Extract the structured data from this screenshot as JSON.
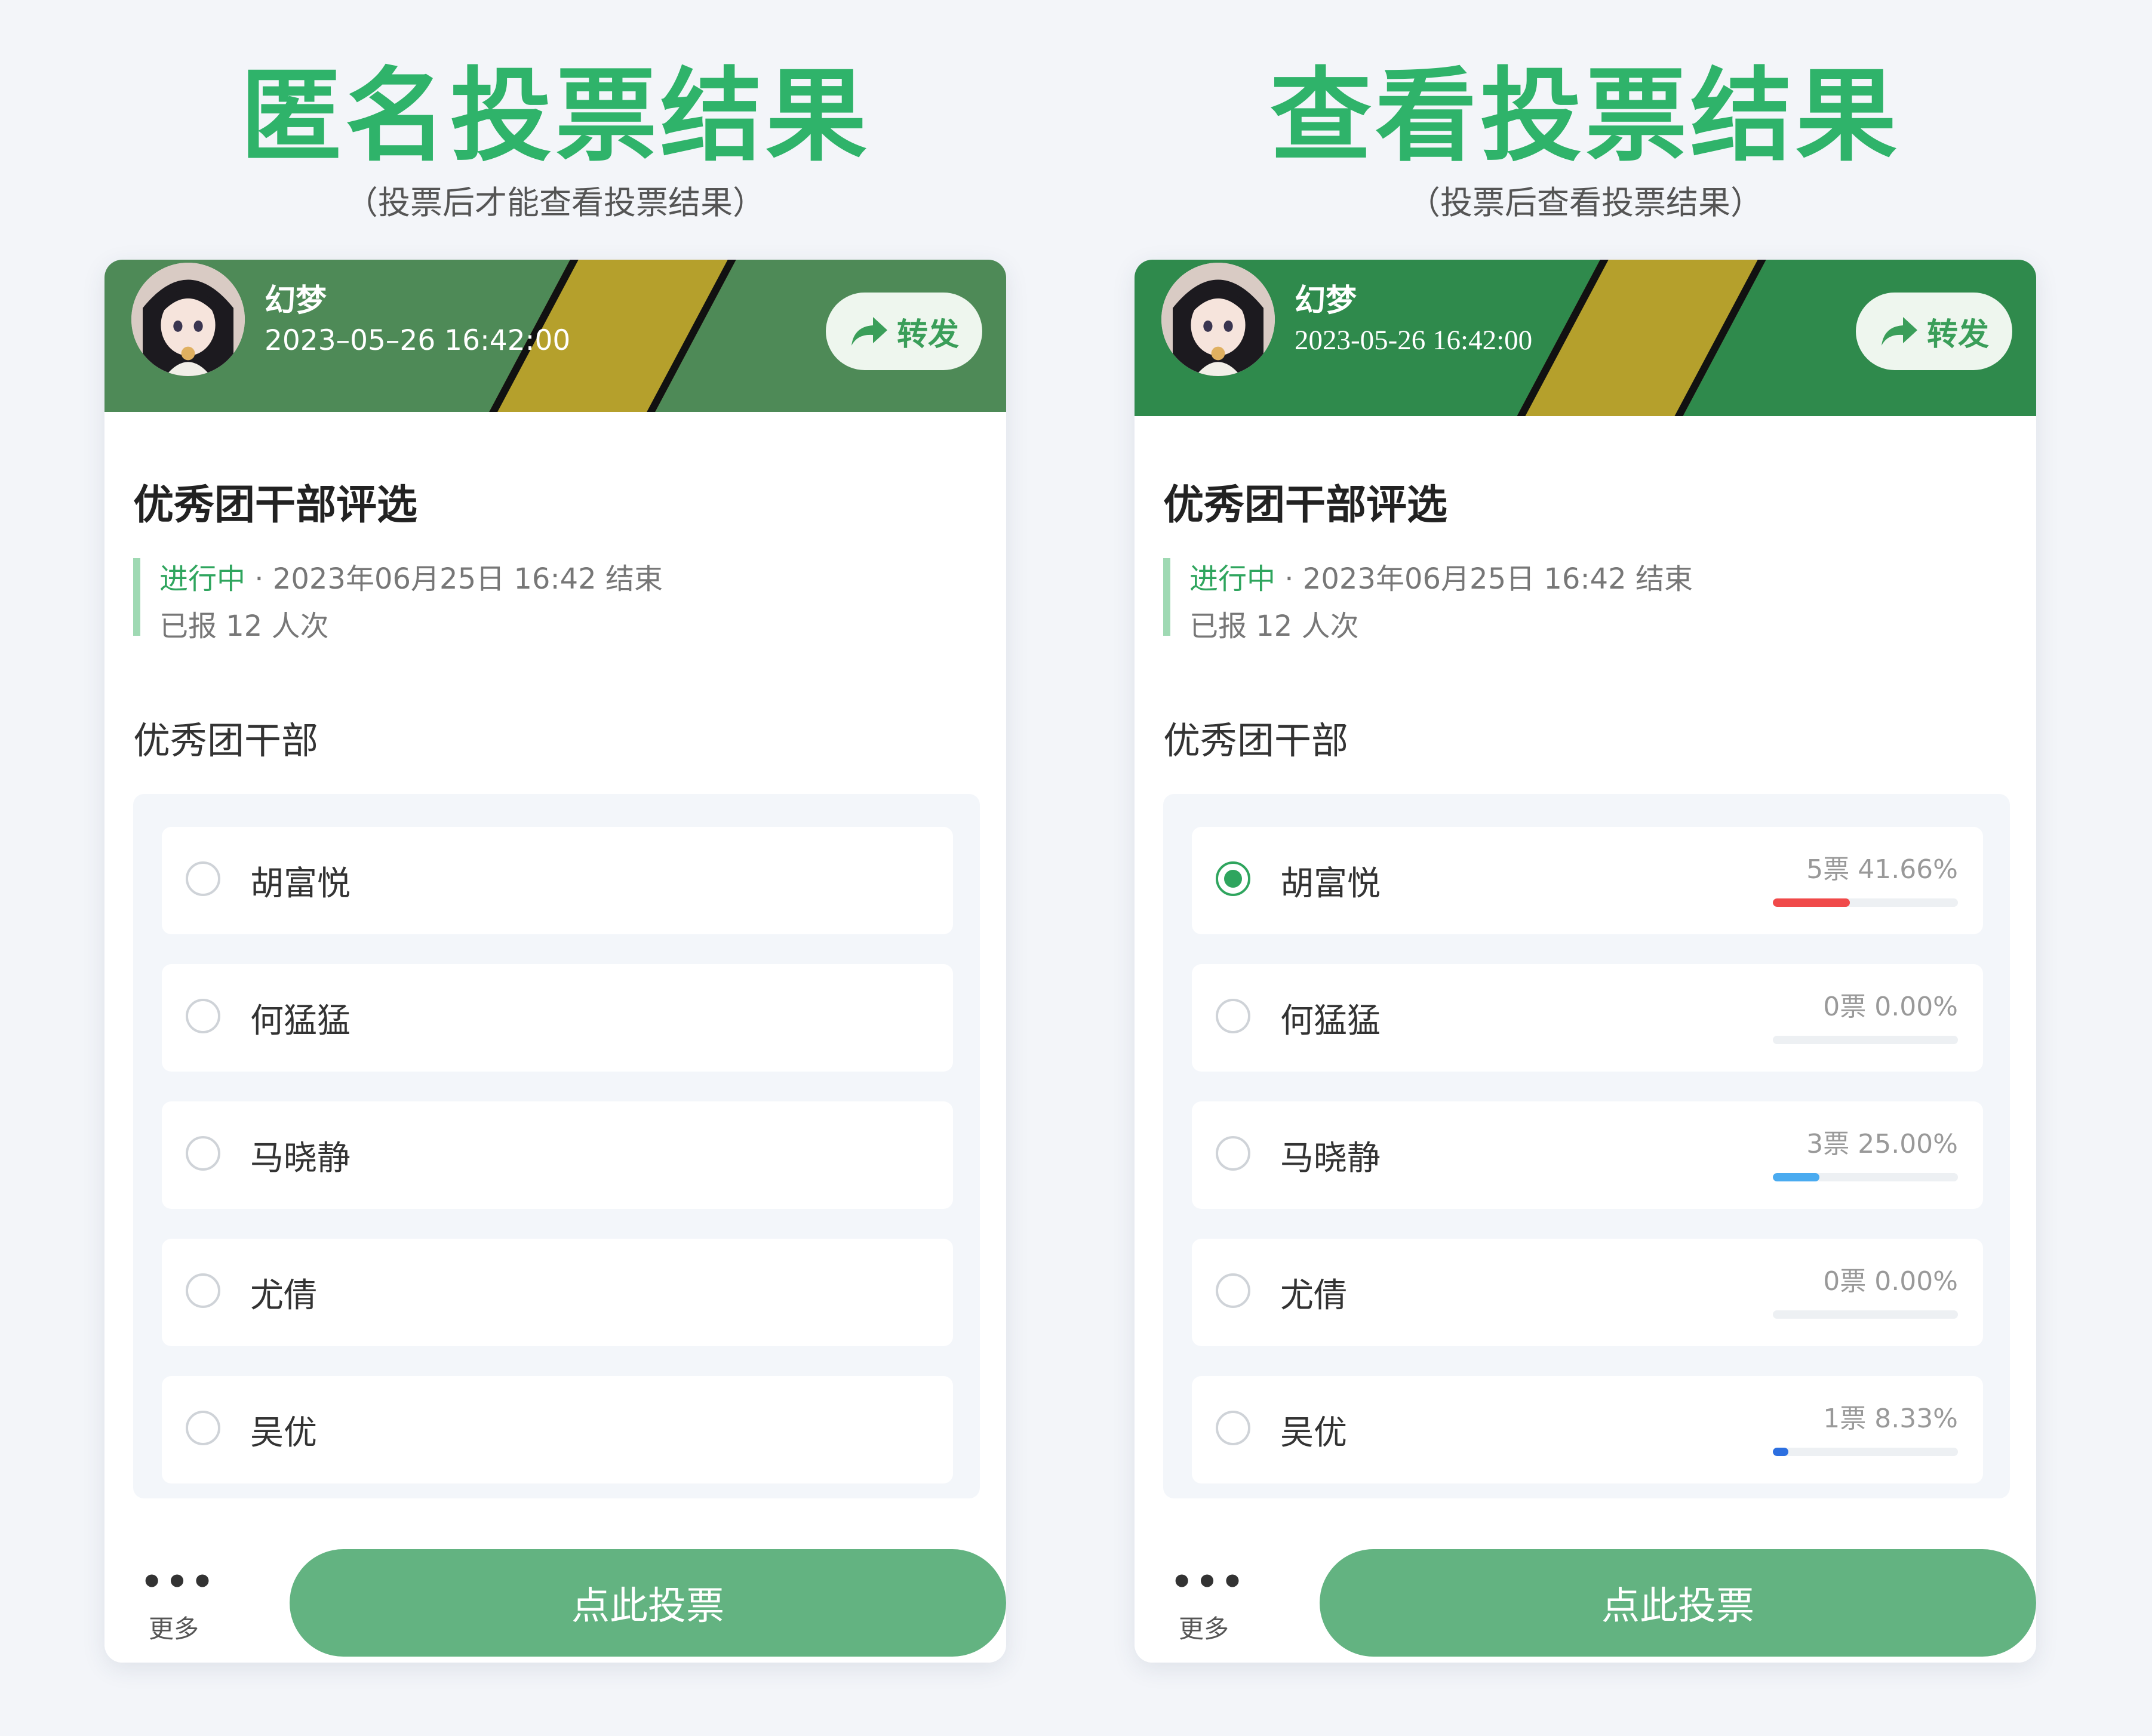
{
  "left": {
    "heading": "匿名投票结果",
    "subheading": "（投票后才能查看投票结果）",
    "user": {
      "name": "幻梦",
      "datetime": "2023–05–26 16:42:00"
    },
    "share_label": "转发",
    "vote_title": "优秀团干部评选",
    "status": {
      "state": "进行中",
      "separator": " · ",
      "end_text": "2023年06月25日 16:42 结束"
    },
    "participant_count": "已报 12 人次",
    "question": "优秀团干部",
    "options": [
      {
        "name": "胡富悦"
      },
      {
        "name": "何猛猛"
      },
      {
        "name": "马晓静"
      },
      {
        "name": "尤倩"
      },
      {
        "name": "吴优"
      }
    ],
    "footer": {
      "more_icon": "•••",
      "more_label": "更多",
      "vote_button": "点此投票"
    }
  },
  "right": {
    "heading": "查看投票结果",
    "subheading": "（投票后查看投票结果）",
    "user": {
      "name": "幻梦",
      "datetime": "2023-05-26 16:42:00"
    },
    "share_label": "转发",
    "vote_title": "优秀团干部评选",
    "status": {
      "state": "进行中",
      "separator": " · ",
      "end_text": "2023年06月25日 16:42 结束"
    },
    "participant_count": "已报 12 人次",
    "question": "优秀团干部",
    "options": [
      {
        "name": "胡富悦",
        "stat": "5票  41.66%",
        "fraction": 0.4166,
        "bar_color": "#f04a4a",
        "selected": true
      },
      {
        "name": "何猛猛",
        "stat": "0票  0.00%",
        "fraction": 0,
        "bar_color": "#cccccc",
        "selected": false
      },
      {
        "name": "马晓静",
        "stat": "3票  25.00%",
        "fraction": 0.25,
        "bar_color": "#4aabf0",
        "selected": false
      },
      {
        "name": "尤倩",
        "stat": "0票  0.00%",
        "fraction": 0,
        "bar_color": "#cccccc",
        "selected": false
      },
      {
        "name": "吴优",
        "stat": "1票  8.33%",
        "fraction": 0.0833,
        "bar_color": "#2c6fe0",
        "selected": false
      }
    ],
    "footer": {
      "more_icon": "•••",
      "more_label": "更多",
      "vote_button": "点此投票"
    }
  },
  "colors": {
    "accent_green": "#2fb36a",
    "header_green": "#4e8a57",
    "button_green": "#63b381"
  }
}
